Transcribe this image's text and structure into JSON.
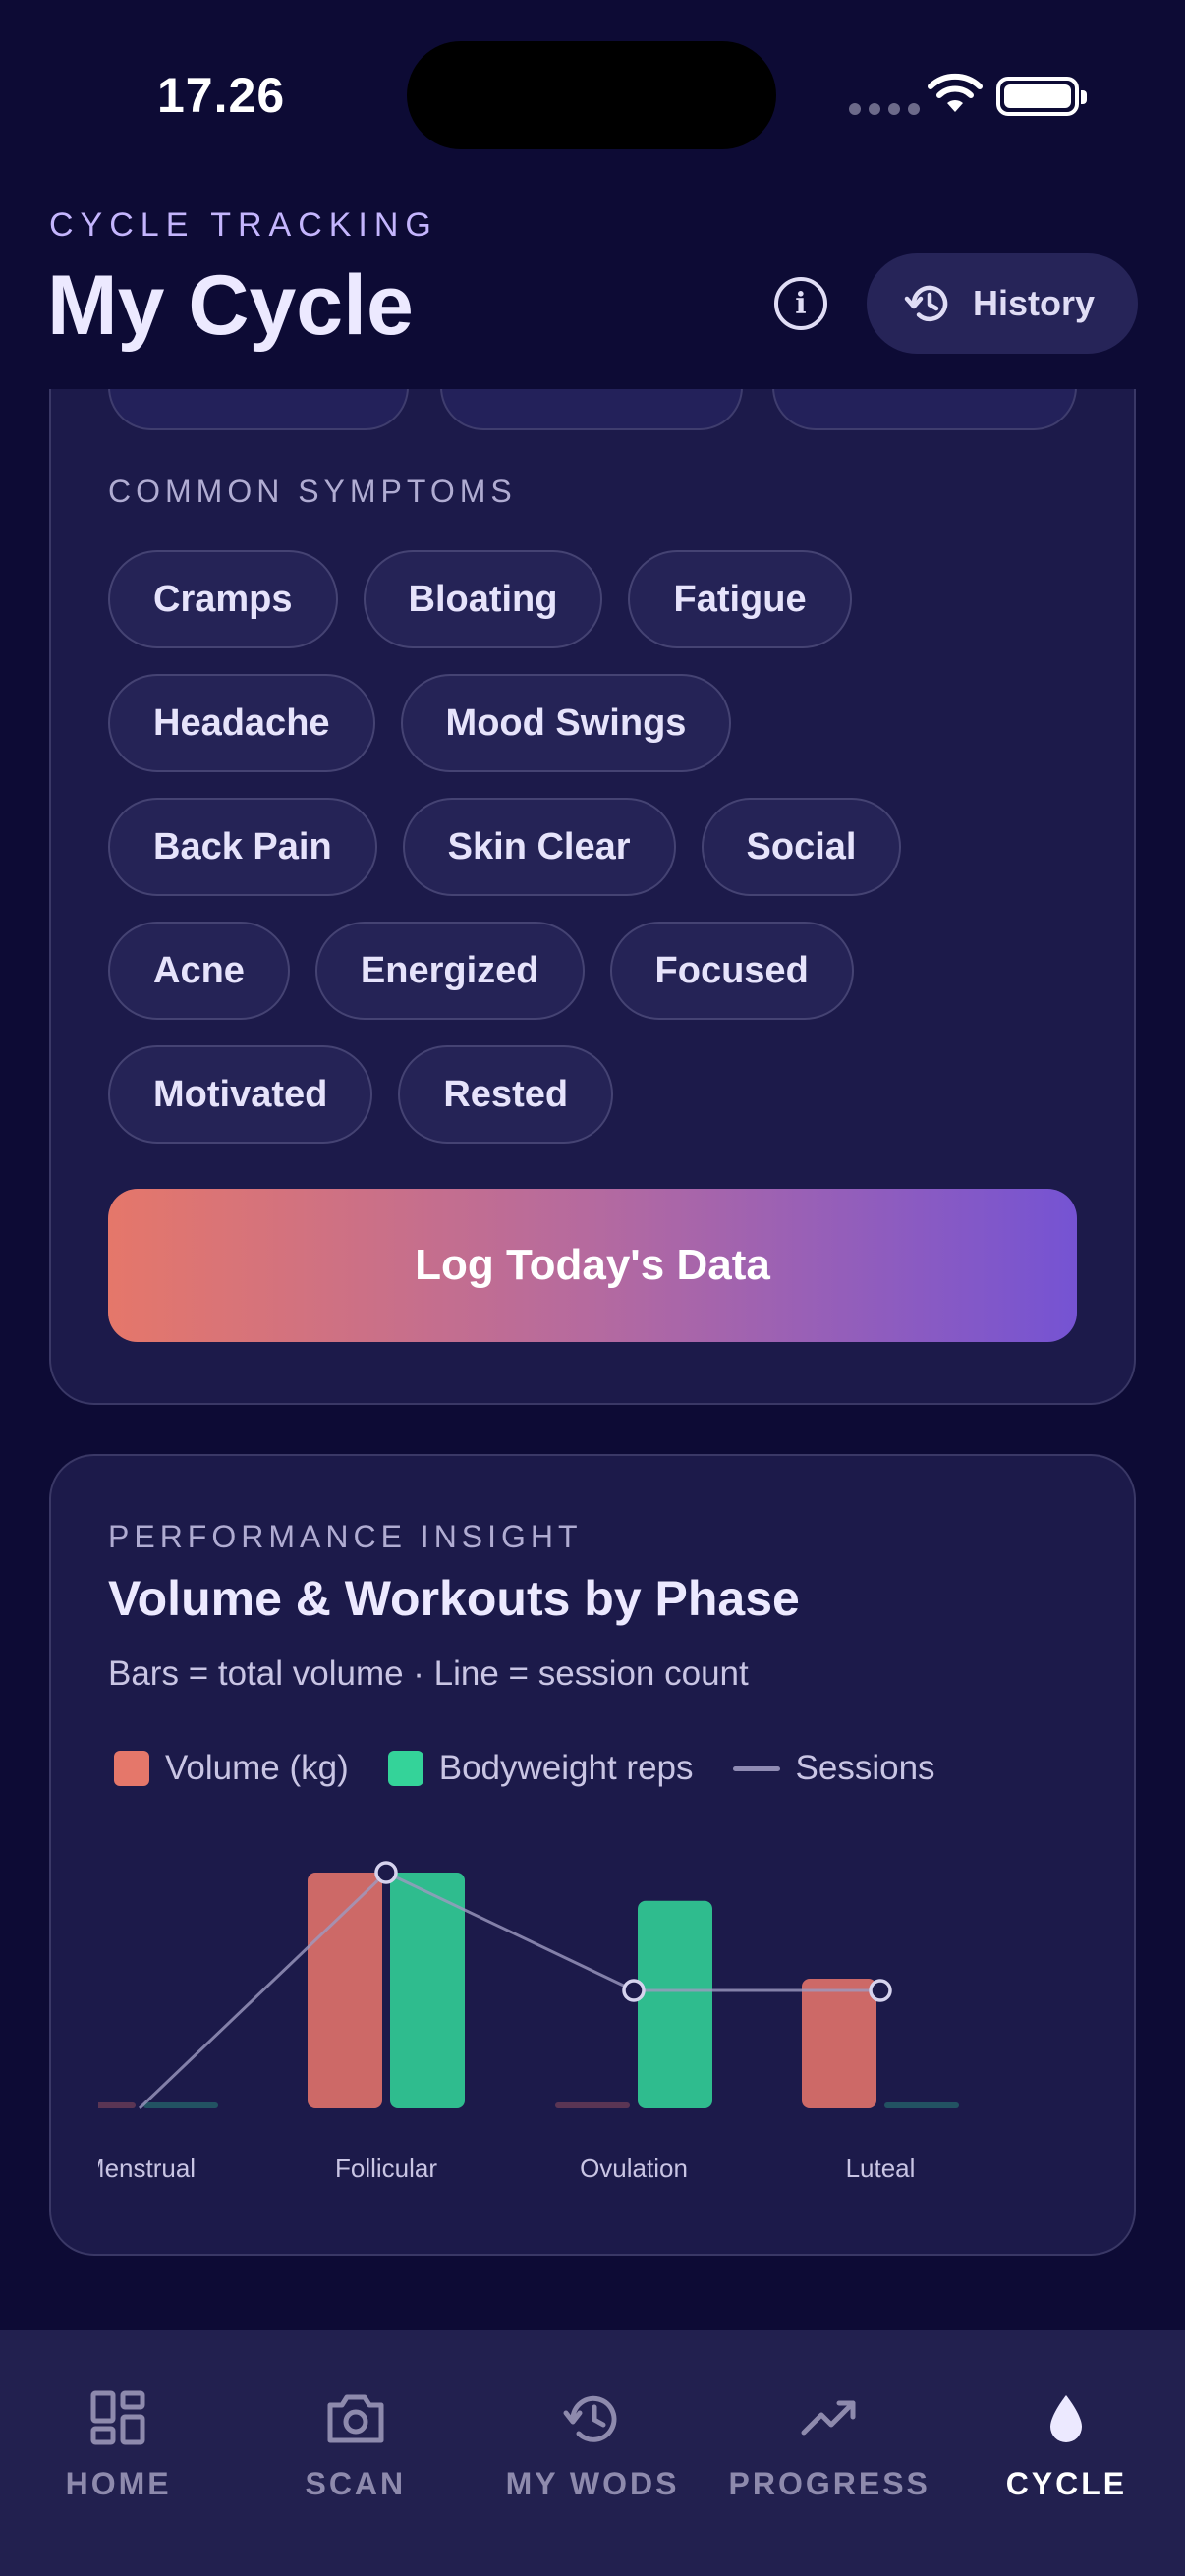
{
  "status": {
    "time": "17.26"
  },
  "header": {
    "eyebrow": "CYCLE TRACKING",
    "title": "My Cycle",
    "history_label": "History"
  },
  "log_card": {
    "symptoms_label": "COMMON SYMPTOMS",
    "chip_rows": [
      [
        "Cramps",
        "Bloating",
        "Fatigue"
      ],
      [
        "Headache",
        "Mood Swings"
      ],
      [
        "Back Pain",
        "Skin Clear",
        "Social"
      ],
      [
        "Acne",
        "Energized",
        "Focused"
      ],
      [
        "Motivated",
        "Rested"
      ]
    ],
    "log_button": "Log Today's Data"
  },
  "insight": {
    "eyebrow": "PERFORMANCE INSIGHT",
    "title": "Volume & Workouts by Phase",
    "subtitle": "Bars = total volume · Line = session count",
    "legend": {
      "volume": "Volume (kg)",
      "bodyweight": "Bodyweight reps",
      "sessions": "Sessions"
    }
  },
  "chart_data": {
    "type": "bar",
    "categories": [
      "Menstrual",
      "Follicular",
      "Ovulation",
      "Luteal"
    ],
    "series": [
      {
        "name": "Volume (kg)",
        "values": [
          0,
          1,
          0,
          0.55
        ],
        "color": "#cd6967"
      },
      {
        "name": "Bodyweight reps",
        "values": [
          0,
          1,
          0.88,
          0
        ],
        "color": "#2fbc8e"
      },
      {
        "name": "Sessions",
        "values": [
          0,
          1,
          0.5,
          0.5
        ],
        "color": "#8f8bb3"
      }
    ],
    "ylim": [
      0,
      1
    ],
    "grid": false,
    "legend": "top-left"
  },
  "nav": [
    {
      "label": "HOME",
      "icon": "home-icon"
    },
    {
      "label": "SCAN",
      "icon": "camera-icon"
    },
    {
      "label": "MY WODS",
      "icon": "history-icon"
    },
    {
      "label": "PROGRESS",
      "icon": "trend-icon"
    },
    {
      "label": "CYCLE",
      "icon": "drop-icon"
    }
  ]
}
